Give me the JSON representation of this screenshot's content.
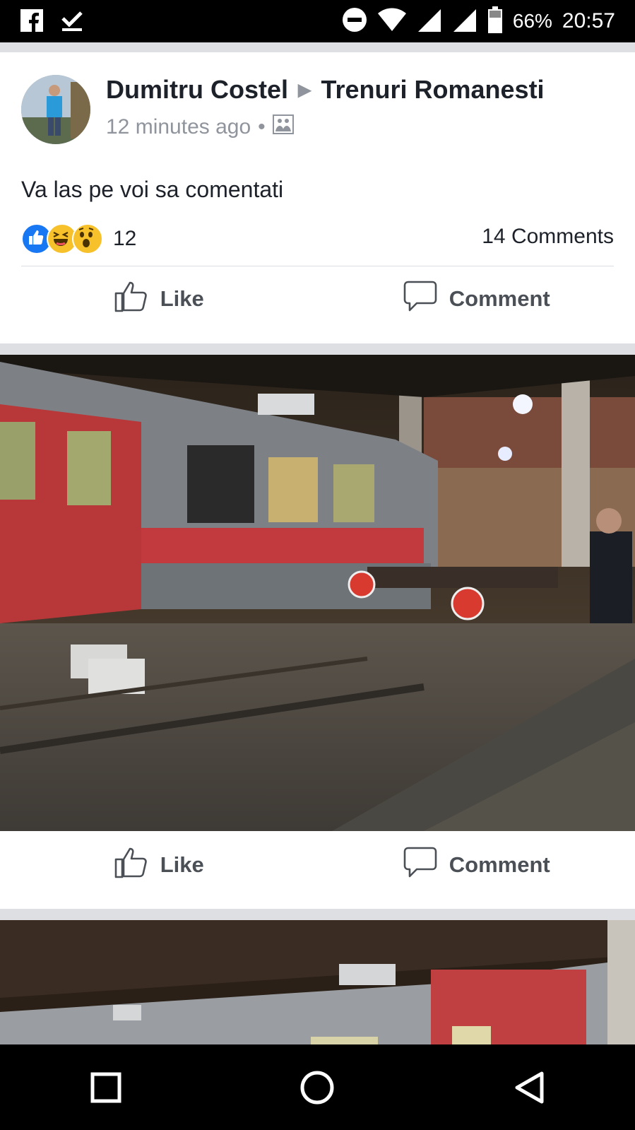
{
  "status_bar": {
    "left_icons": [
      "facebook-icon",
      "download-done-icon"
    ],
    "right_icons": [
      "do-not-disturb-icon",
      "wifi-icon",
      "signal-icon",
      "signal-icon-2",
      "battery-icon"
    ],
    "battery": "66%",
    "time": "20:57"
  },
  "post": {
    "author": "Dumitru Costel",
    "group": "Trenuri Romanesti",
    "timestamp": "12 minutes ago",
    "separator": "•",
    "privacy_icon": "photo-album-icon",
    "text": "Va las pe voi sa comentati",
    "reactions": {
      "types": [
        "like",
        "haha",
        "wow"
      ],
      "count": "12"
    },
    "comments": "14 Comments"
  },
  "actions": {
    "like": "Like",
    "comment": "Comment"
  },
  "nav": {
    "icons": [
      "recent-apps-icon",
      "home-icon",
      "back-icon"
    ]
  },
  "colors": {
    "accent": "#1877f2",
    "text": "#1d2129",
    "meta": "#90949c",
    "action": "#4b4f56"
  }
}
